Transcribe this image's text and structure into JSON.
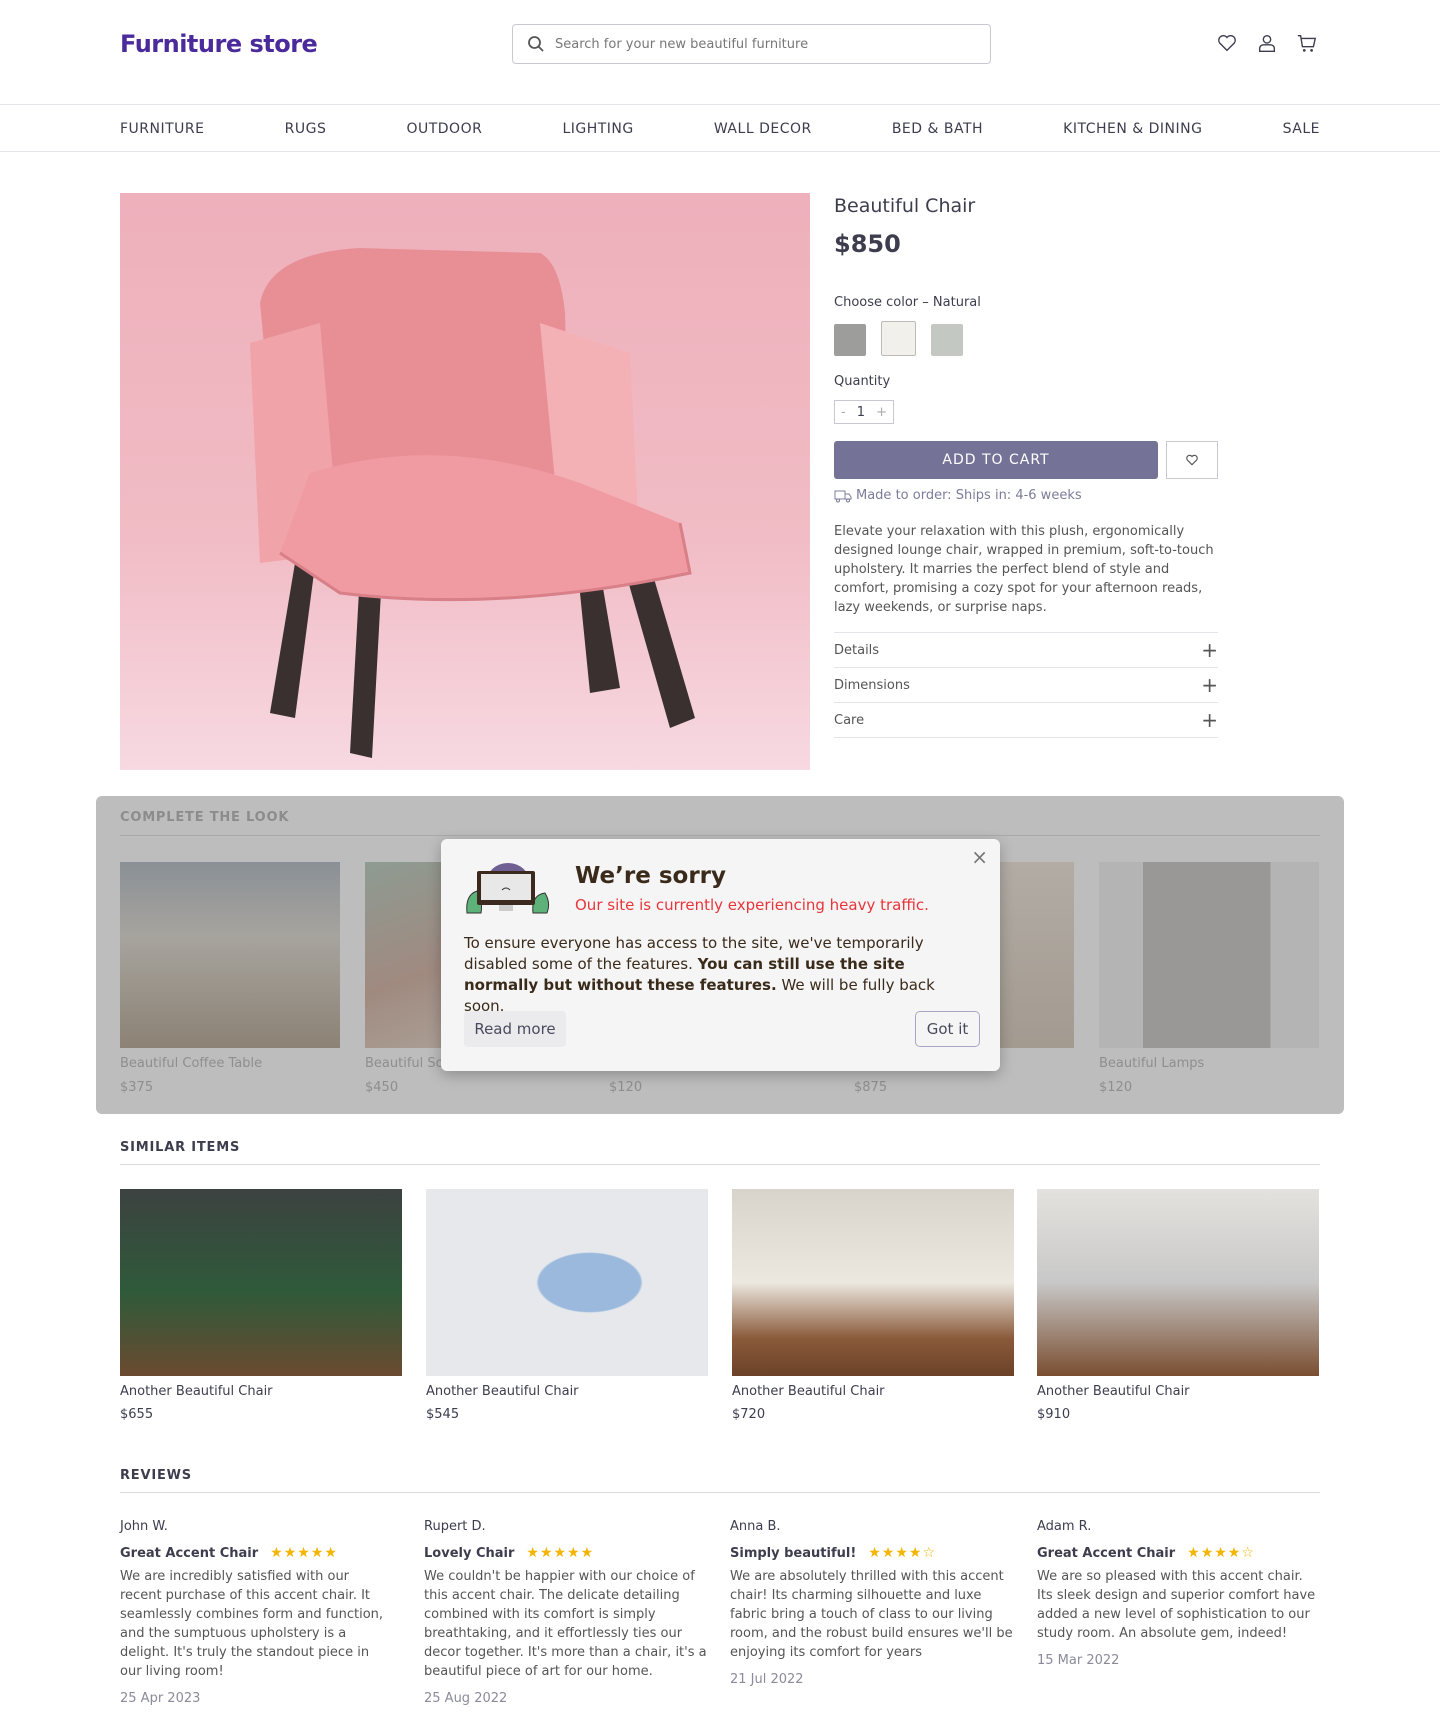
{
  "header": {
    "logo": "Furniture store",
    "search_placeholder": "Search for your new beautiful furniture",
    "icons": [
      "heart-icon",
      "user-icon",
      "cart-icon"
    ]
  },
  "nav": [
    "FURNITURE",
    "RUGS",
    "OUTDOOR",
    "LIGHTING",
    "WALL DECOR",
    "BED & BATH",
    "KITCHEN & DINING",
    "SALE"
  ],
  "product": {
    "title": "Beautiful Chair",
    "price": "$850",
    "color_label": "Choose color –",
    "color_value": "Natural",
    "swatches": [
      "#9d9d9b",
      "#f1f0ea",
      "#c3c8c3"
    ],
    "quantity_label": "Quantity",
    "quantity_minus": "-",
    "quantity": "1",
    "quantity_plus": "+",
    "add_to_cart": "ADD TO CART",
    "shipping": "Made to order: Ships in: 4-6 weeks",
    "description": "Elevate your relaxation with this plush, ergonomically designed lounge chair, wrapped in premium, soft-to-touch upholstery. It marries the perfect blend of style and comfort, promising a cozy spot for your afternoon reads, lazy weekends, or surprise naps.",
    "accordion": [
      "Details",
      "Dimensions",
      "Care"
    ],
    "accent": "#747297"
  },
  "complete_look": {
    "heading": "COMPLETE THE LOOK",
    "items": [
      {
        "name": "Beautiful Coffee Table",
        "price": "$375"
      },
      {
        "name": "Beautiful Sofa",
        "price": "$450"
      },
      {
        "name": "",
        "price": "$120"
      },
      {
        "name": "",
        "price": "$875"
      },
      {
        "name": "Beautiful Lamps",
        "price": "$120"
      }
    ]
  },
  "popup": {
    "title": "We’re sorry",
    "subtitle": "Our site is currently experiencing heavy traffic.",
    "body_start": "To ensure everyone has access to the site, we've temporarily disabled some of the features. ",
    "body_bold": "You can still use the site normally but without these features.",
    "body_end": " We will be fully back soon.",
    "read_more": "Read more",
    "got_it": "Got it",
    "close": "×",
    "error_color": "#e8353b"
  },
  "similar": {
    "heading": "SIMILAR ITEMS",
    "items": [
      {
        "name": "Another Beautiful Chair",
        "price": "$655"
      },
      {
        "name": "Another Beautiful Chair",
        "price": "$545"
      },
      {
        "name": "Another Beautiful Chair",
        "price": "$720"
      },
      {
        "name": "Another Beautiful Chair",
        "price": "$910"
      }
    ]
  },
  "reviews": {
    "heading": "REVIEWS",
    "items": [
      {
        "author": "John W.",
        "title": "Great Accent Chair",
        "rating": 5,
        "stars": "★★★★★",
        "text": "We are incredibly satisfied with our recent purchase of this accent chair. It seamlessly combines form and function, and the sumptuous upholstery is a delight. It's truly the standout piece in our living room!",
        "date": "25 Apr 2023"
      },
      {
        "author": "Rupert D.",
        "title": "Lovely Chair",
        "rating": 5,
        "stars": "★★★★★",
        "text": "We couldn't be happier with our choice of this accent chair. The delicate detailing combined with its comfort is simply breathtaking, and it effortlessly ties our decor together. It's more than a chair, it's a beautiful piece of art for our home.",
        "date": "25 Aug 2022"
      },
      {
        "author": "Anna B.",
        "title": "Simply beautiful!",
        "rating": 4.5,
        "stars": "★★★★☆",
        "text": "We are absolutely thrilled with this accent chair! Its charming silhouette and luxe fabric bring a touch of class to our living room, and the robust build ensures we'll be enjoying its comfort for years",
        "date": "21 Jul 2022"
      },
      {
        "author": "Adam R.",
        "title": "Great Accent Chair",
        "rating": 4.5,
        "stars": "★★★★☆",
        "text": "We are so pleased with this accent chair. Its sleek design and superior comfort have added a new level of sophistication to our study room. An absolute gem, indeed!",
        "date": "15 Mar 2022"
      }
    ]
  }
}
